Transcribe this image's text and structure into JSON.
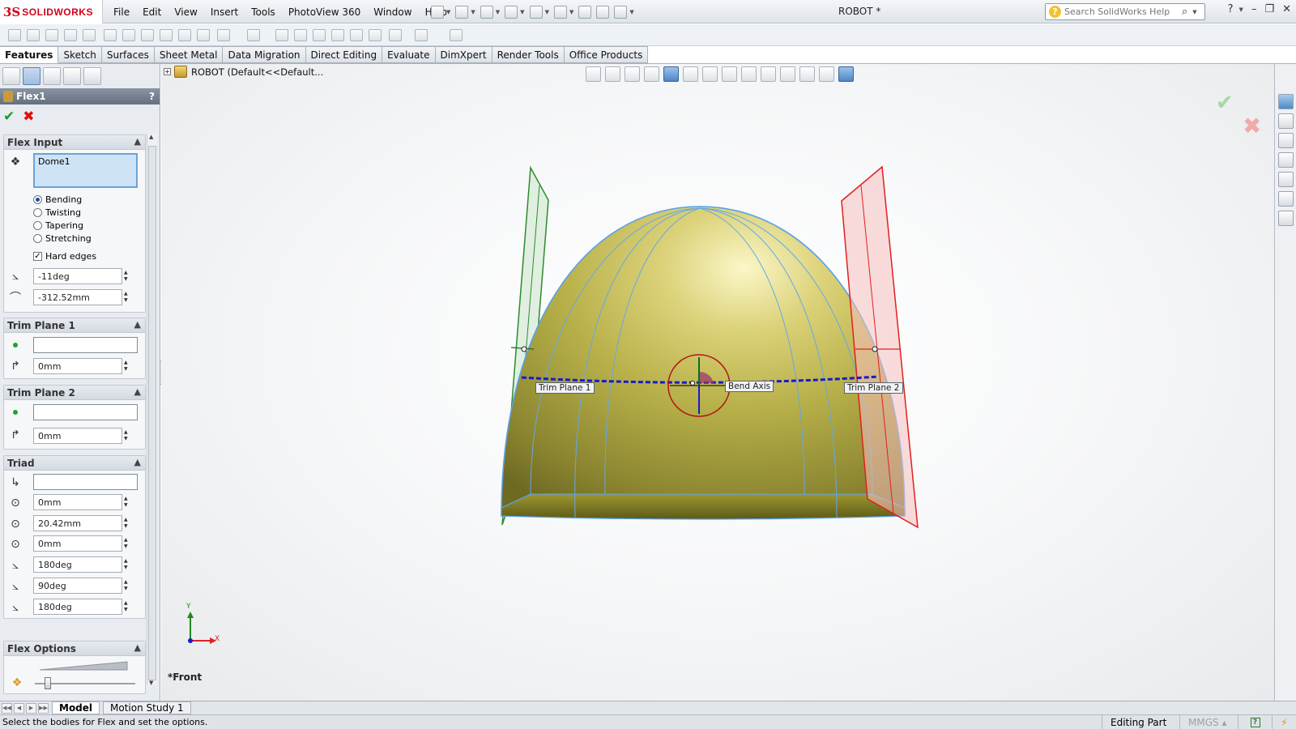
{
  "app": {
    "logo_ds": "3S",
    "logo_name": "SOLIDWORKS",
    "document_title": "ROBOT *"
  },
  "menu": [
    "File",
    "Edit",
    "View",
    "Insert",
    "Tools",
    "PhotoView 360",
    "Window",
    "Help"
  ],
  "search": {
    "placeholder": "Search SolidWorks Help"
  },
  "tabs": [
    "Features",
    "Sketch",
    "Surfaces",
    "Sheet Metal",
    "Data Migration",
    "Direct Editing",
    "Evaluate",
    "DimXpert",
    "Render Tools",
    "Office Products"
  ],
  "active_tab": "Features",
  "property_manager": {
    "title": "Flex1",
    "help": "?",
    "flex_input": {
      "header": "Flex Input",
      "bodies_value": "Dome1",
      "modes": [
        {
          "label": "Bending",
          "selected": true
        },
        {
          "label": "Twisting",
          "selected": false
        },
        {
          "label": "Tapering",
          "selected": false
        },
        {
          "label": "Stretching",
          "selected": false
        }
      ],
      "hard_edges_label": "Hard edges",
      "hard_edges_checked": true,
      "angle_value": "-11deg",
      "radius_value": "-312.52mm"
    },
    "trim_plane_1": {
      "header": "Trim Plane 1",
      "entity": "",
      "distance": "0mm"
    },
    "trim_plane_2": {
      "header": "Trim Plane 2",
      "entity": "",
      "distance": "0mm"
    },
    "triad": {
      "header": "Triad",
      "entity": "",
      "x_value": "0mm",
      "y_value": "20.42mm",
      "z_value": "0mm",
      "rot_x": "180deg",
      "rot_y": "90deg",
      "rot_z": "180deg"
    },
    "flex_options": {
      "header": "Flex Options",
      "accuracy_level": 0.1
    }
  },
  "feature_tree": {
    "root": "ROBOT  (Default<<Default..."
  },
  "viewport": {
    "view_name": "*Front",
    "callouts": {
      "trim1": "Trim Plane 1",
      "trim2": "Trim Plane 2",
      "bend_axis": "Bend Axis"
    },
    "axis_x": "X",
    "axis_y": "Y"
  },
  "bottom_tabs": [
    "Model",
    "Motion Study 1"
  ],
  "status": {
    "message": "Select the bodies for Flex and set the options.",
    "mode": "Editing Part",
    "units": "MMGS"
  },
  "colors": {
    "dome": "#b8b14a",
    "plane_left": "#2e8b2e",
    "plane_right": "#e02020",
    "bend_axis": "#1a1acc",
    "accent": "#d0021b"
  }
}
